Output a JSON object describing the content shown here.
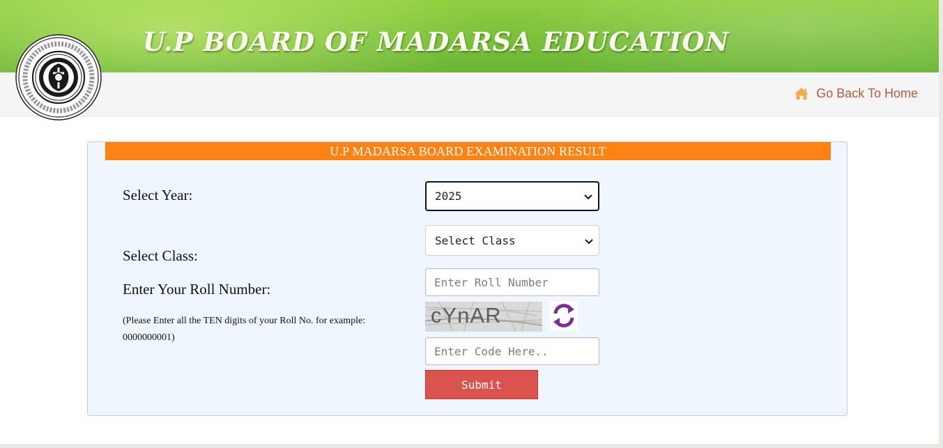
{
  "header": {
    "site_title": "U.P BOARD OF MADARSA EDUCATION",
    "logo_icon": "board-emblem-icon"
  },
  "nav": {
    "home_link_label": "Go Back To Home",
    "home_icon": "home-icon",
    "home_color": "#f0ad4e"
  },
  "form": {
    "heading": "U.P MADARSA BOARD EXAMINATION RESULT",
    "heading_bg": "#ff8212",
    "year_label": "Select Year:",
    "year_value": "2025",
    "class_label": "Select Class:",
    "class_value": "Select Class",
    "roll_label": "Enter Your Roll Number:",
    "roll_hint": "(Please Enter all the TEN digits of your Roll No. for example: 0000000001)",
    "roll_placeholder": "Enter Roll Number",
    "captcha_text": "cYnAR",
    "refresh_icon": "refresh-icon",
    "code_placeholder": "Enter Code Here..",
    "submit_label": "Submit",
    "submit_color": "#d9534f"
  }
}
